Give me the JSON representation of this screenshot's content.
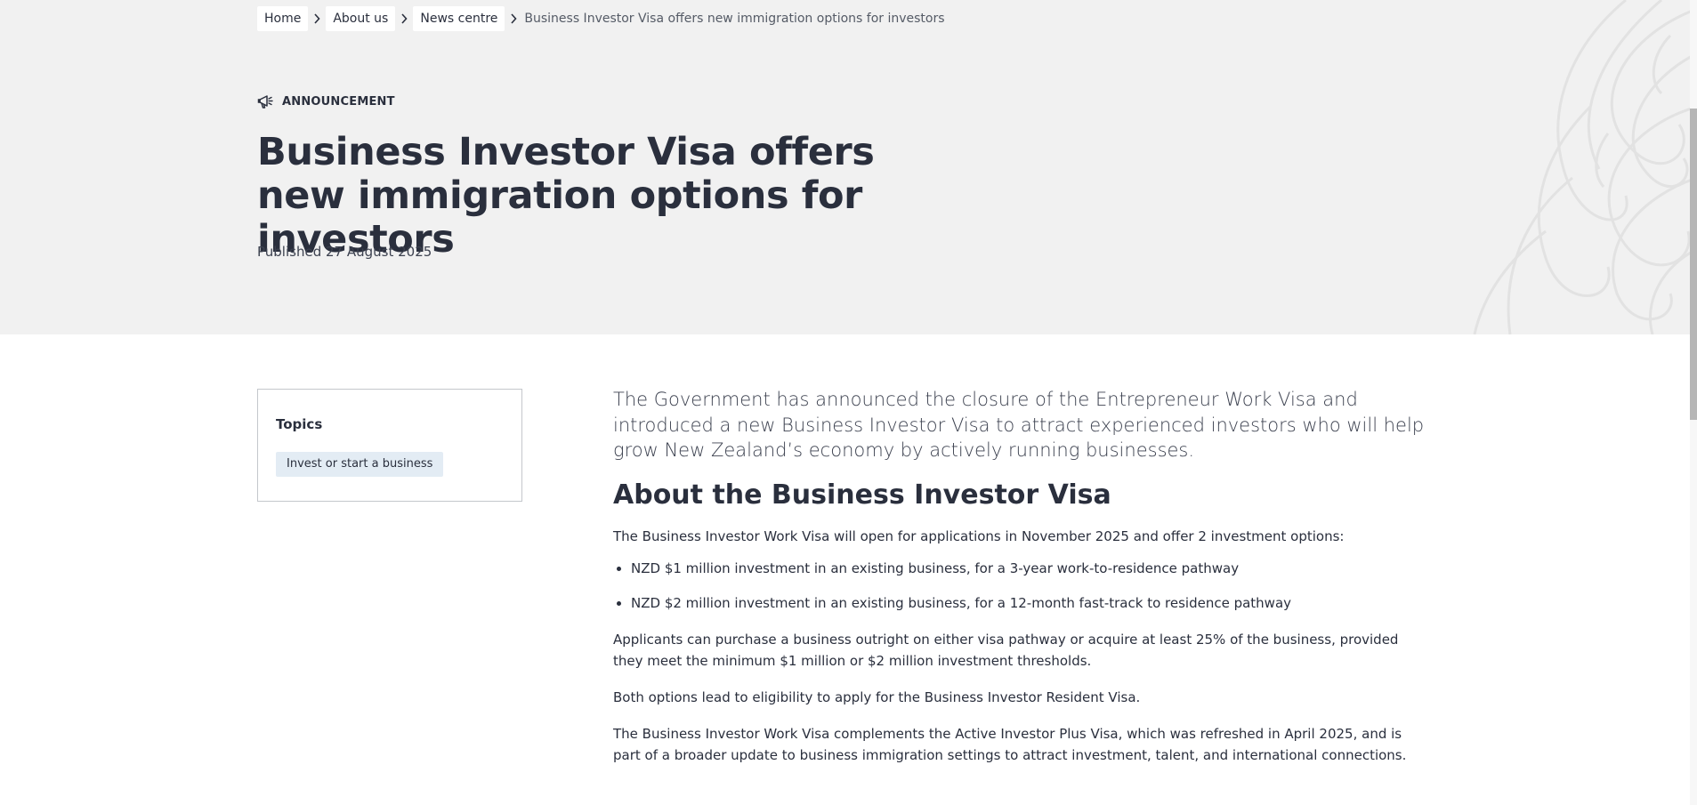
{
  "breadcrumb": {
    "items": [
      "Home",
      "About us",
      "News centre"
    ],
    "current": "Business Investor Visa offers new immigration options for investors"
  },
  "hero": {
    "category": "ANNOUNCEMENT",
    "category_icon": "megaphone-icon",
    "title": "Business Investor Visa offers new immigration options for investors",
    "published": "Published 27 August 2025"
  },
  "topics": {
    "heading": "Topics",
    "tags": [
      "Invest or start a business"
    ]
  },
  "article": {
    "lead": "The Government has announced the closure of the Entrepreneur Work Visa and introduced a new Business Investor Visa to attract experienced investors who will help grow New Zealand’s economy by actively running businesses.",
    "section_heading": "About the Business Investor Visa",
    "intro": "The Business Investor Work Visa will open for applications in November 2025 and offer 2 investment options:",
    "bullets": [
      "NZD $1 million investment in an existing business, for a 3-year work-to-residence pathway",
      "NZD $2 million investment in an existing business, for a 12-month fast-track to residence pathway"
    ],
    "para1": "Applicants can purchase a business outright on either visa pathway or acquire at least 25% of the business, provided they meet the minimum $1 million or $2 million investment thresholds.",
    "para2": "Both options lead to eligibility to apply for the Business Investor Resident Visa.",
    "para3": "The Business Investor Work Visa complements the Active Investor Plus Visa, which was refreshed in April 2025, and is part of a broader update to business immigration settings to attract investment, talent, and international connections."
  },
  "colors": {
    "hero_background": "#f1f1f1",
    "text": "#2a2f3d",
    "tag_background": "#e3ecf4"
  }
}
